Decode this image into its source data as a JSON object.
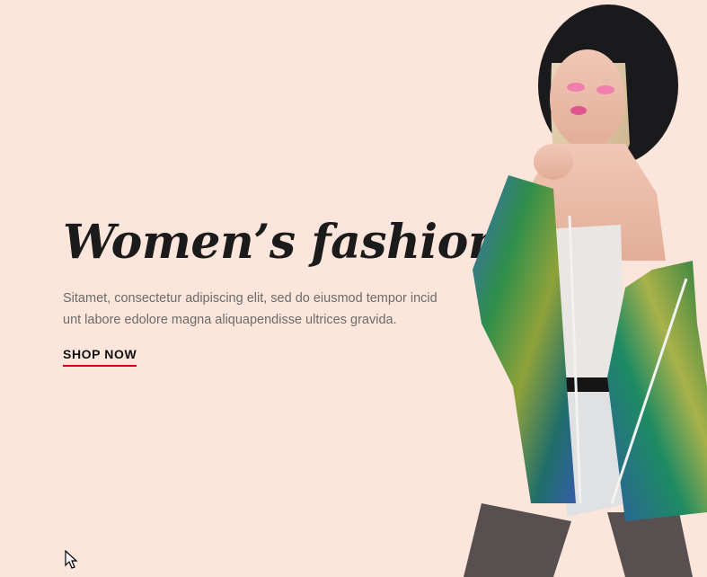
{
  "hero": {
    "title": "Women’s fashion",
    "description_lines": [
      "Sitamet, consectetur adipiscing elit, sed do eiusmod tempor incid",
      "unt labore edolore magna aliquapendisse ultrices gravida."
    ],
    "cta_label": "SHOP NOW",
    "colors": {
      "background": "#fce6dc",
      "accent": "#d0021b",
      "title": "#1b1b1b",
      "text": "#6b6b6b"
    }
  },
  "image": {
    "subject": "model-photo"
  }
}
